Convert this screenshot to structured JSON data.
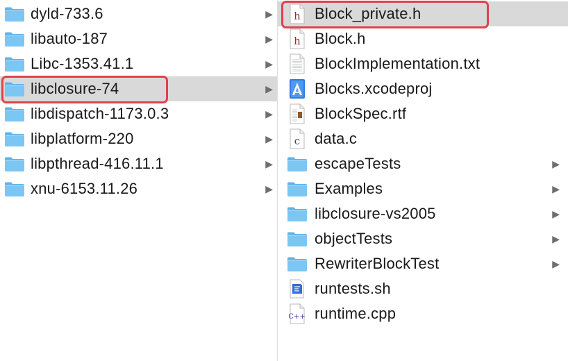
{
  "left_column": {
    "items": [
      {
        "label": "dyld-733.6",
        "icon": "folder-icon"
      },
      {
        "label": "libauto-187",
        "icon": "folder-icon"
      },
      {
        "label": "Libc-1353.41.1",
        "icon": "folder-icon"
      },
      {
        "label": "libclosure-74",
        "icon": "folder-icon",
        "selected": true,
        "highlighted": true
      },
      {
        "label": "libdispatch-1173.0.3",
        "icon": "folder-icon"
      },
      {
        "label": "libplatform-220",
        "icon": "folder-icon"
      },
      {
        "label": "libpthread-416.11.1",
        "icon": "folder-icon"
      },
      {
        "label": "xnu-6153.11.26",
        "icon": "folder-icon"
      }
    ]
  },
  "right_column": {
    "items": [
      {
        "label": "Block_private.h",
        "icon": "h-header-file-icon",
        "selected": true,
        "highlighted": true
      },
      {
        "label": "Block.h",
        "icon": "h-header-file-icon"
      },
      {
        "label": "BlockImplementation.txt",
        "icon": "text-document-icon"
      },
      {
        "label": "Blocks.xcodeproj",
        "icon": "xcode-project-icon"
      },
      {
        "label": "BlockSpec.rtf",
        "icon": "rtf-document-icon"
      },
      {
        "label": "data.c",
        "icon": "c-source-file-icon"
      },
      {
        "label": "escapeTests",
        "icon": "folder-icon",
        "folder": true
      },
      {
        "label": "Examples",
        "icon": "folder-icon",
        "folder": true
      },
      {
        "label": "libclosure-vs2005",
        "icon": "folder-icon",
        "folder": true
      },
      {
        "label": "objectTests",
        "icon": "folder-icon",
        "folder": true
      },
      {
        "label": "RewriterBlockTest",
        "icon": "folder-icon",
        "folder": true
      },
      {
        "label": "runtests.sh",
        "icon": "shell-script-icon"
      },
      {
        "label": "runtime.cpp",
        "icon": "cpp-source-file-icon"
      }
    ]
  },
  "chevron_glyph": "▶",
  "colors": {
    "selection": "#d9d9d9",
    "highlight_border": "#e0414b",
    "folder_body": "#6cc0f3",
    "folder_tab": "#7dc9f5"
  }
}
